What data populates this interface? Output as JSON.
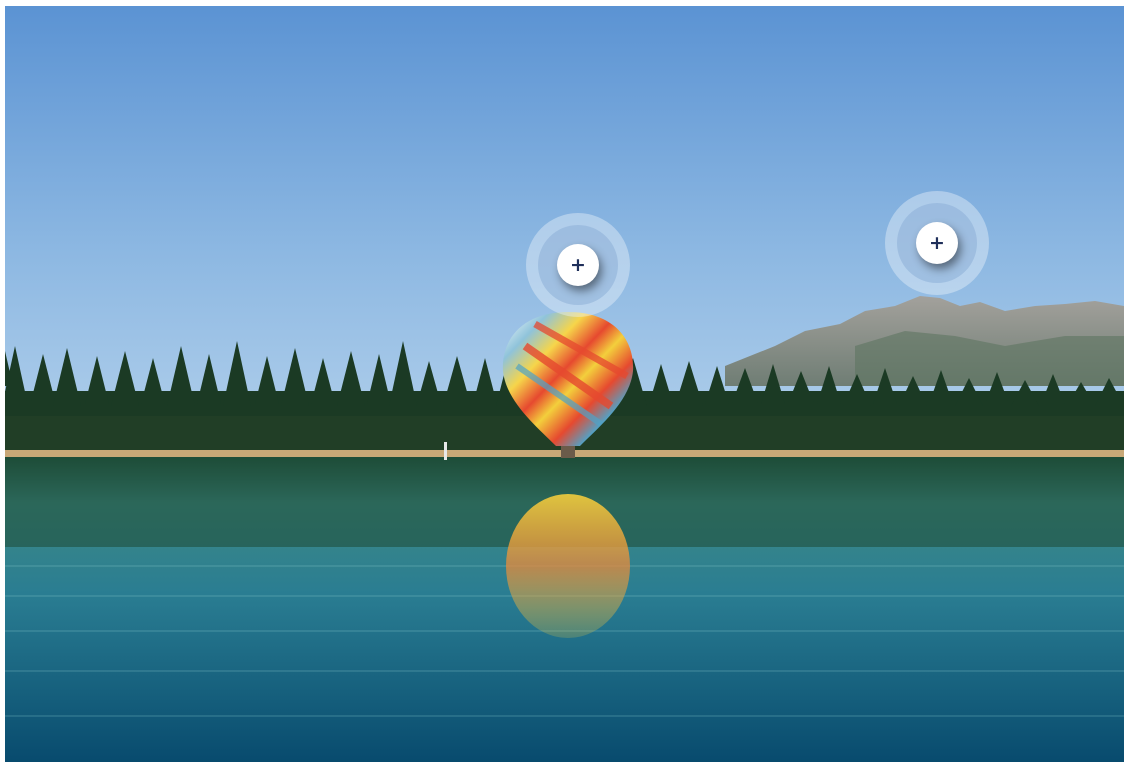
{
  "scene": {
    "colors": {
      "sky_top": "#5f97d6",
      "sky_bottom": "#a9c9e9",
      "mountain": "#8f9397",
      "forest": "#1c3a24",
      "shore": "#c7a678",
      "water_top": "#3d8580",
      "water_bottom": "#0b4f73",
      "balloon_yellow": "#f3cf3c",
      "balloon_red": "#e3472e",
      "balloon_blue": "#4fa3c8"
    }
  },
  "hotspots": [
    {
      "id": "balloon",
      "icon": "plus-icon",
      "symbol": "+",
      "accent": "#1f2f5a"
    },
    {
      "id": "mountain",
      "icon": "plus-icon",
      "symbol": "+",
      "accent": "#1f2f5a"
    }
  ]
}
